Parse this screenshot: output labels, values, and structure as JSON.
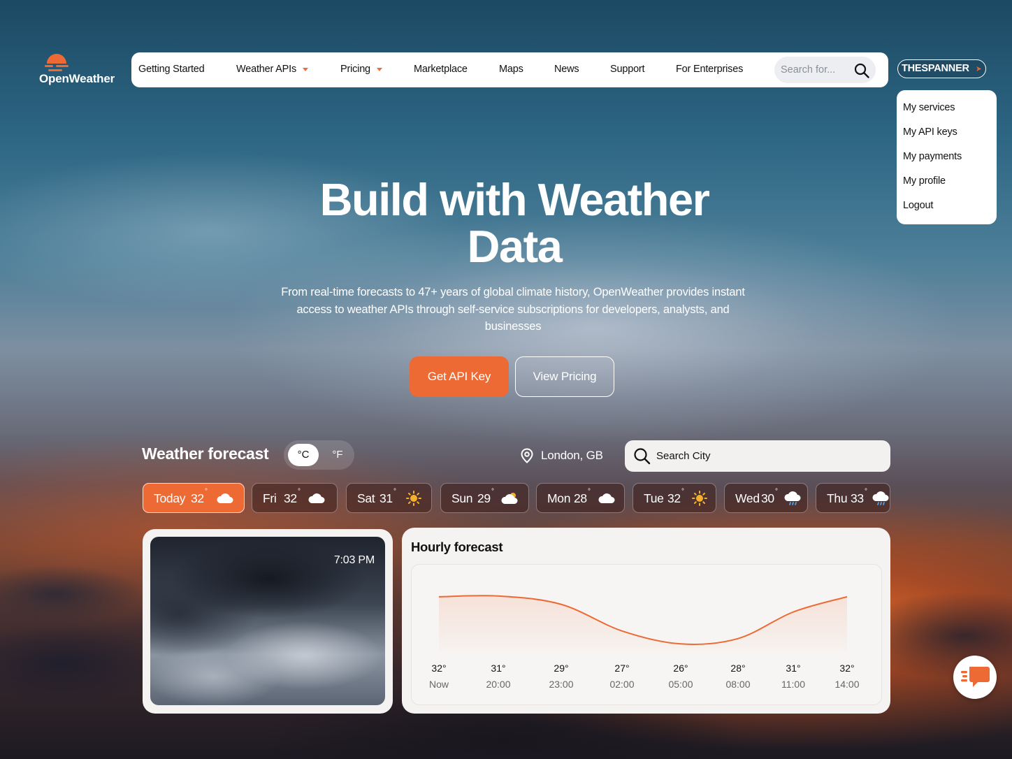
{
  "logo": {
    "text": "OpenWeather"
  },
  "nav": {
    "items": [
      {
        "label": "Getting Started",
        "dropdown": false
      },
      {
        "label": "Weather APIs",
        "dropdown": true
      },
      {
        "label": "Pricing",
        "dropdown": true
      },
      {
        "label": "Marketplace",
        "dropdown": false
      },
      {
        "label": "Maps",
        "dropdown": false
      },
      {
        "label": "News",
        "dropdown": false
      },
      {
        "label": "Support",
        "dropdown": false
      },
      {
        "label": "For Enterprises",
        "dropdown": false
      }
    ],
    "search_placeholder": "Search for..."
  },
  "user": {
    "name": "THESPANNER",
    "menu": [
      "My services",
      "My API keys",
      "My payments",
      "My profile",
      "Logout"
    ]
  },
  "hero": {
    "title_line1": "Build with Weather",
    "title_line2": "Data",
    "subtitle": "From real-time forecasts to 47+ years of global climate history, OpenWeather provides instant access to weather APIs through self-service subscriptions for developers, analysts, and businesses",
    "primary_button": "Get API Key",
    "secondary_button": "View Pricing"
  },
  "forecast": {
    "title": "Weather forecast",
    "unit_c": "°C",
    "unit_f": "°F",
    "selected_unit": "°C",
    "location": "London, GB",
    "city_search_placeholder": "Search City",
    "days": [
      {
        "day": "Today",
        "temp": "32",
        "icon": "cloud-icon",
        "active": true
      },
      {
        "day": "Fri",
        "temp": "32",
        "icon": "cloud-icon",
        "active": false
      },
      {
        "day": "Sat",
        "temp": "31",
        "icon": "sun-icon",
        "active": false
      },
      {
        "day": "Sun",
        "temp": "29",
        "icon": "sun-cloud-icon",
        "active": false
      },
      {
        "day": "Mon",
        "temp": "28",
        "icon": "cloud-icon",
        "active": false
      },
      {
        "day": "Tue",
        "temp": "32",
        "icon": "sun-icon",
        "active": false
      },
      {
        "day": "Wed",
        "temp": "30",
        "icon": "rain-cloud-icon",
        "active": false
      },
      {
        "day": "Thu",
        "temp": "33",
        "icon": "rain-cloud-icon",
        "active": false
      }
    ],
    "photo_time": "7:03 PM",
    "hourly_title": "Hourly forecast"
  },
  "chart_data": {
    "type": "area",
    "title": "Hourly forecast",
    "x": [
      "Now",
      "20:00",
      "23:00",
      "02:00",
      "05:00",
      "08:00",
      "11:00",
      "14:00"
    ],
    "temps": [
      32,
      31,
      29,
      27,
      26,
      28,
      31,
      32
    ],
    "temp_labels": [
      "32°",
      "31°",
      "29°",
      "27°",
      "26°",
      "28°",
      "31°",
      "32°"
    ],
    "series": [
      {
        "values": [
          32,
          32.1,
          31,
          27.5,
          25.8,
          26.5,
          30,
          32
        ]
      }
    ],
    "ylim": [
      25,
      33
    ],
    "line_color": "#ec6a34",
    "grid": false
  },
  "colors": {
    "accent": "#ee6a34",
    "text_dark": "#111111"
  }
}
